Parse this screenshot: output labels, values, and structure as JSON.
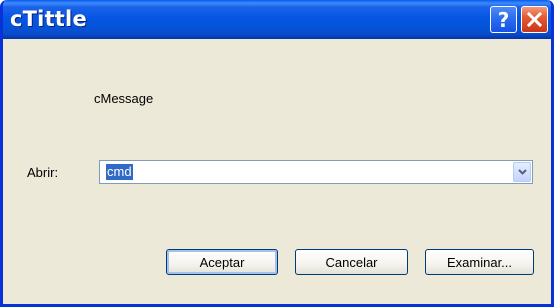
{
  "window": {
    "title": "cTittle",
    "help_label": "?"
  },
  "dialog": {
    "message": "cMessage",
    "open_label": "Abrir:",
    "open_value": "cmd"
  },
  "buttons": {
    "ok": "Aceptar",
    "cancel": "Cancelar",
    "browse": "Examinar..."
  },
  "colors": {
    "titlebar": "#0055E5",
    "window_body": "#ECE9D8",
    "selection": "#316AC5",
    "close_button": "#E45B34"
  },
  "icons": {
    "help": "help-icon",
    "close": "close-icon",
    "dropdown": "chevron-down-icon"
  }
}
